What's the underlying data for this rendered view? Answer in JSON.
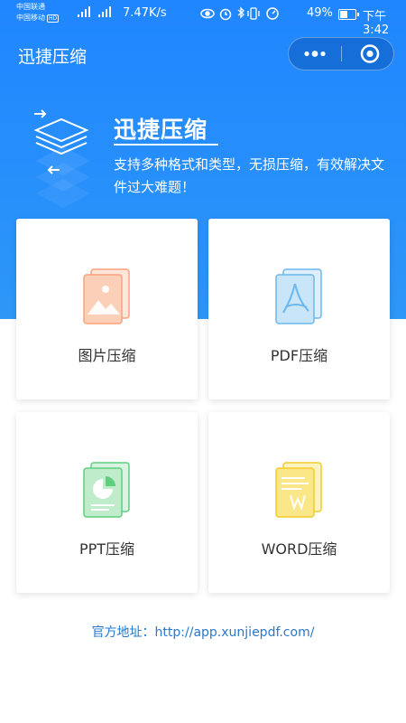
{
  "status_bar": {
    "carrier_1": "中国联通",
    "carrier_2": "中国移动",
    "hd_badge": "HD",
    "net_speed": "7.47K/s",
    "battery": "49%",
    "time": "下午3:42"
  },
  "header": {
    "title": "迅捷压缩"
  },
  "banner": {
    "title": "迅捷压缩",
    "description": "支持多种格式和类型，无损压缩，有效解决文件过大难题！"
  },
  "cards": [
    {
      "label": "图片压缩",
      "icon": "image-file-icon",
      "color": "#f9a27c"
    },
    {
      "label": "PDF压缩",
      "icon": "pdf-file-icon",
      "color": "#6cb8ec"
    },
    {
      "label": "PPT压缩",
      "icon": "ppt-file-icon",
      "color": "#5fcf7f"
    },
    {
      "label": "WORD压缩",
      "icon": "word-file-icon",
      "color": "#f2cc2c"
    }
  ],
  "footer": {
    "text": "官方地址：http://app.xunjiepdf.com/"
  },
  "colors": {
    "header_blue": "#1f86ff",
    "accent": "#2a78c8"
  }
}
